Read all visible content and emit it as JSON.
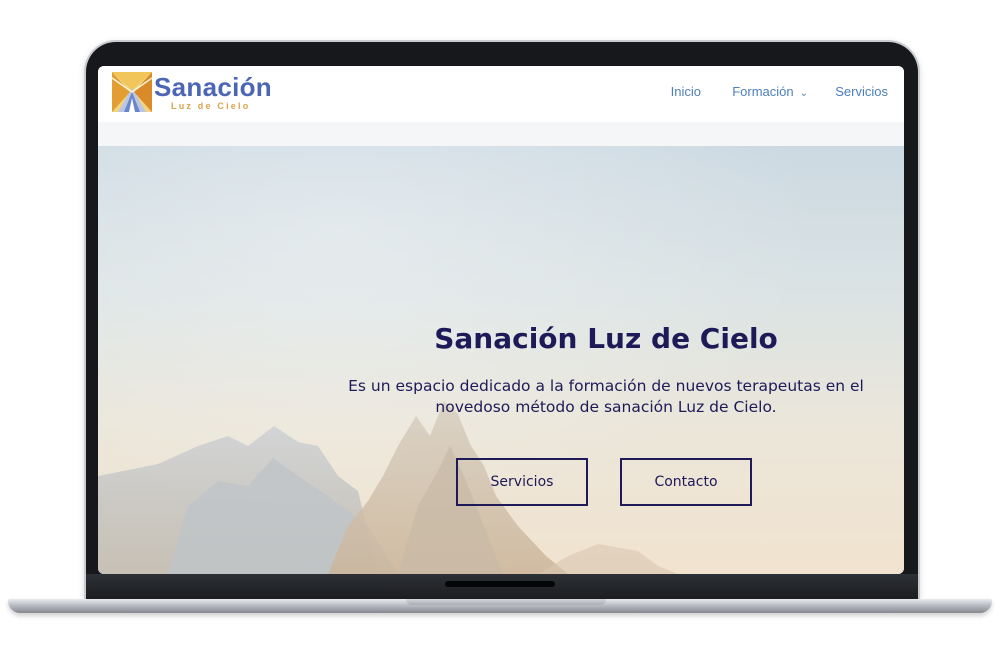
{
  "brand": {
    "title": "Sanación",
    "subtitle": "Luz de Cielo",
    "colors": {
      "title": "#4c66b6",
      "subtitle": "#d9a44b",
      "mark_gold": "#e9b54a"
    }
  },
  "nav": {
    "items": [
      {
        "label": "Inicio"
      },
      {
        "label": "Formación",
        "dropdown": true
      },
      {
        "label": "Servicios"
      }
    ],
    "color": "#4c7fbd"
  },
  "hero": {
    "title": "Sanación Luz de Cielo",
    "text_line1": "Es un espacio dedicado a la formación de nuevos terapeutas en el",
    "text_line2": "novedoso método de sanación Luz de Cielo.",
    "buttons": [
      {
        "label": "Servicios"
      },
      {
        "label": "Contacto"
      }
    ],
    "text_color": "#1e1a58"
  },
  "icons": {
    "logo": "sun-rays-logo-icon",
    "dropdown": "chevron-down-icon"
  }
}
